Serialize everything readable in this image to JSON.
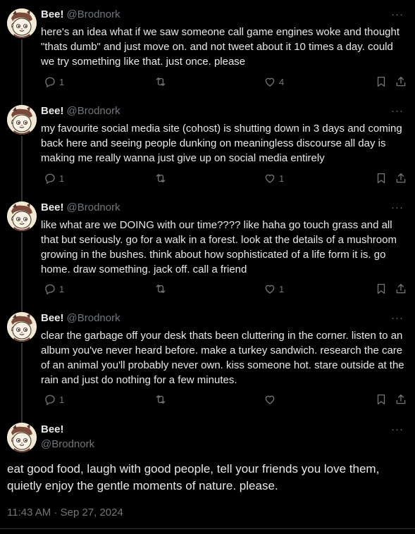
{
  "thread": [
    {
      "name": "Bee!",
      "handle": "@Brodnork",
      "text": "here's an idea what if we saw someone call game engines woke and thought \"thats dumb\" and just move on. and not tweet about it 10 times a day. could we try something like that. just once. please",
      "replies": "1",
      "likes": "4"
    },
    {
      "name": "Bee!",
      "handle": "@Brodnork",
      "text": "my favourite social media site (cohost) is shutting down in 3 days and coming back here and seeing people dunking on meaningless discourse all day is making me really wanna just give up on social media entirely",
      "replies": "1",
      "likes": "1"
    },
    {
      "name": "Bee!",
      "handle": "@Brodnork",
      "text": "like what are we DOING with our time???? like haha go touch grass and all that but seriously. go for a walk in a forest. look at the details of a mushroom growing in the bushes. think about how sophisticated of a life form it is. go home. draw something. jack off. call a friend",
      "replies": "1",
      "likes": "1"
    },
    {
      "name": "Bee!",
      "handle": "@Brodnork",
      "text": "clear the garbage off your desk thats been cluttering in the corner. listen to an album you've never heard before. make a turkey sandwich. research the care of an animal you'll probably never own. kiss someone hot. stare outside at the rain and just do nothing for a few minutes.",
      "replies": "1",
      "likes": ""
    }
  ],
  "main": {
    "name": "Bee!",
    "handle": "@Brodnork",
    "text": "eat good food, laugh with good people, tell your friends you love them, quietly enjoy the gentle moments of nature. please.",
    "timestamp": "11:43 AM · Sep 27, 2024"
  },
  "more_label": "···",
  "icons": {
    "reply": "reply-icon",
    "retweet": "retweet-icon",
    "like": "heart-icon",
    "bookmark": "bookmark-icon",
    "share": "share-icon",
    "more": "more-icon"
  },
  "colors": {
    "background": "#000000",
    "text": "#e7e9ea",
    "muted": "#71767b",
    "thread_line": "#333639"
  }
}
